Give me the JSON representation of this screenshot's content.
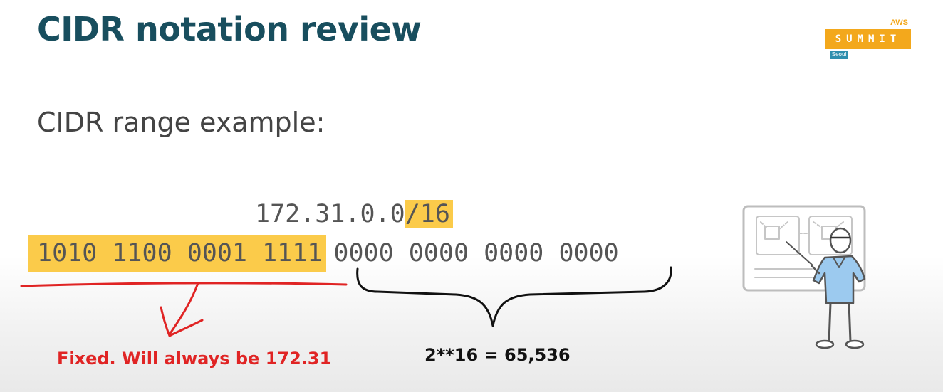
{
  "slide": {
    "title": "CIDR notation review",
    "subtitle": "CIDR range example:"
  },
  "logo": {
    "top_text": "AWS",
    "main_text": "SUMMIT",
    "city_text": "Seoul",
    "color": "#f3a81c",
    "city_color": "#2e8fae"
  },
  "example": {
    "cidr_ip": "172.31.0.0",
    "cidr_prefix": "/16",
    "binary_fixed": "1010 1100 0001 1111",
    "binary_host": "0000 0000 0000 0000",
    "highlight_color": "#fbcb4a"
  },
  "annotations": {
    "fixed_note": "Fixed. Will always be 172.31",
    "fixed_color": "#e02424",
    "host_count_note": "2**16 = 65,536"
  },
  "illustration": {
    "icon": "presenter-whiteboard-icon"
  }
}
